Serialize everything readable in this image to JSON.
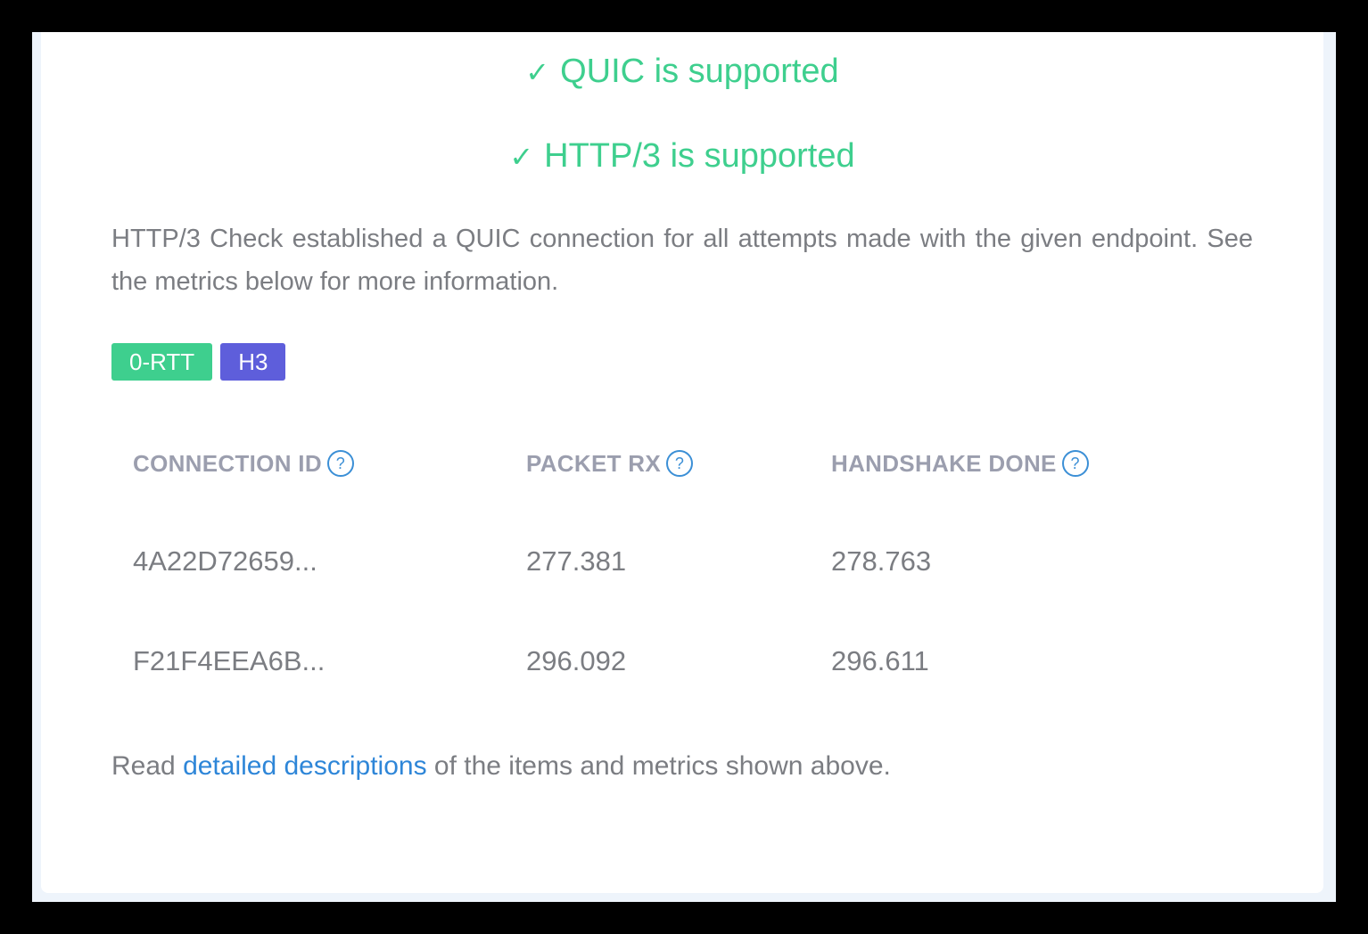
{
  "status": {
    "quic": "QUIC is supported",
    "http3": "HTTP/3 is supported",
    "check_glyph": "✓",
    "color": "#3ecf8e"
  },
  "description": "HTTP/3 Check established a QUIC connection for all attempts made with the given endpoint. See the metrics below for more information.",
  "badges": [
    {
      "label": "0-RTT",
      "color": "#3ecf8e"
    },
    {
      "label": "H3",
      "color": "#5e5edb"
    }
  ],
  "table": {
    "columns": [
      {
        "label": "CONNECTION ID",
        "help_icon": "question-circle-icon"
      },
      {
        "label": "PACKET RX",
        "help_icon": "question-circle-icon"
      },
      {
        "label": "HANDSHAKE DONE",
        "help_icon": "question-circle-icon"
      }
    ],
    "help_glyph": "?",
    "rows": [
      [
        "4A22D72659...",
        "277.381",
        "278.763"
      ],
      [
        "F21F4EEA6B...",
        "296.092",
        "296.611"
      ]
    ]
  },
  "footer": {
    "prefix": "Read ",
    "link": "detailed descriptions",
    "suffix": " of the items and metrics shown above."
  },
  "colors": {
    "accent_green": "#3ecf8e",
    "accent_purple": "#5e5edb",
    "link_blue": "#2e86d8",
    "text_gray": "#7b7d82",
    "header_gray": "#9b9eae"
  }
}
